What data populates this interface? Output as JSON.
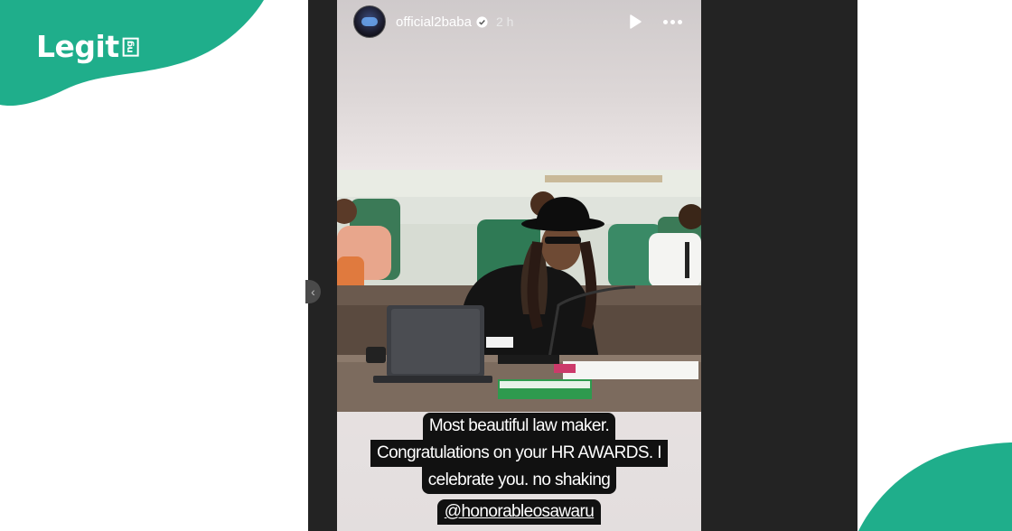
{
  "brand": {
    "name": "Legit",
    "suffix": "ng",
    "color": "#1fae8b"
  },
  "story": {
    "username": "official2baba",
    "time_ago": "2 h",
    "caption_lines": [
      "Most beautiful law maker.",
      "Congratulations on your HR AWARDS. I",
      "celebrate you. no shaking"
    ],
    "mention": "@honorableosawaru"
  },
  "icons": {
    "verified": "verified-badge-icon",
    "play": "play-icon",
    "more": "more-dots-icon",
    "prev": "chevron-left-icon"
  }
}
